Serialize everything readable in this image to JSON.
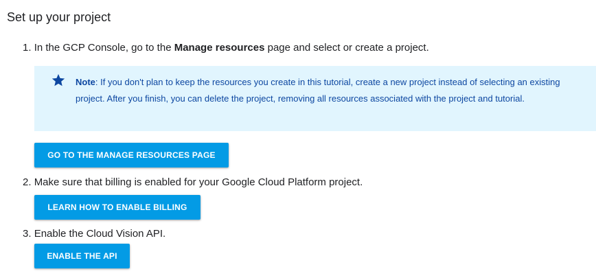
{
  "heading": "Set up your project",
  "steps": [
    {
      "num": "1.",
      "prefix": "In the GCP Console, go to the ",
      "bold": "Manage resources",
      "suffix": " page and select or create a project.",
      "button_label": "GO TO THE MANAGE RESOURCES PAGE"
    },
    {
      "num": "2.",
      "text": "Make sure that billing is enabled for your Google Cloud Platform project.",
      "button_label": "LEARN HOW TO ENABLE BILLING"
    },
    {
      "num": "3.",
      "text": "Enable the Cloud Vision API.",
      "button_label": "ENABLE THE API"
    }
  ],
  "note": {
    "icon": "star-icon",
    "label": "Note",
    "text": ": If you don't plan to keep the resources you create in this tutorial, create a new project instead of selecting an existing project. After you finish, you can delete the project, removing all resources associated with the project and tutorial."
  },
  "colors": {
    "note_background": "#e1f5fe",
    "note_text": "#0d47a1",
    "button": "#039be5",
    "button_text": "#ffffff",
    "body_text": "#202124"
  }
}
